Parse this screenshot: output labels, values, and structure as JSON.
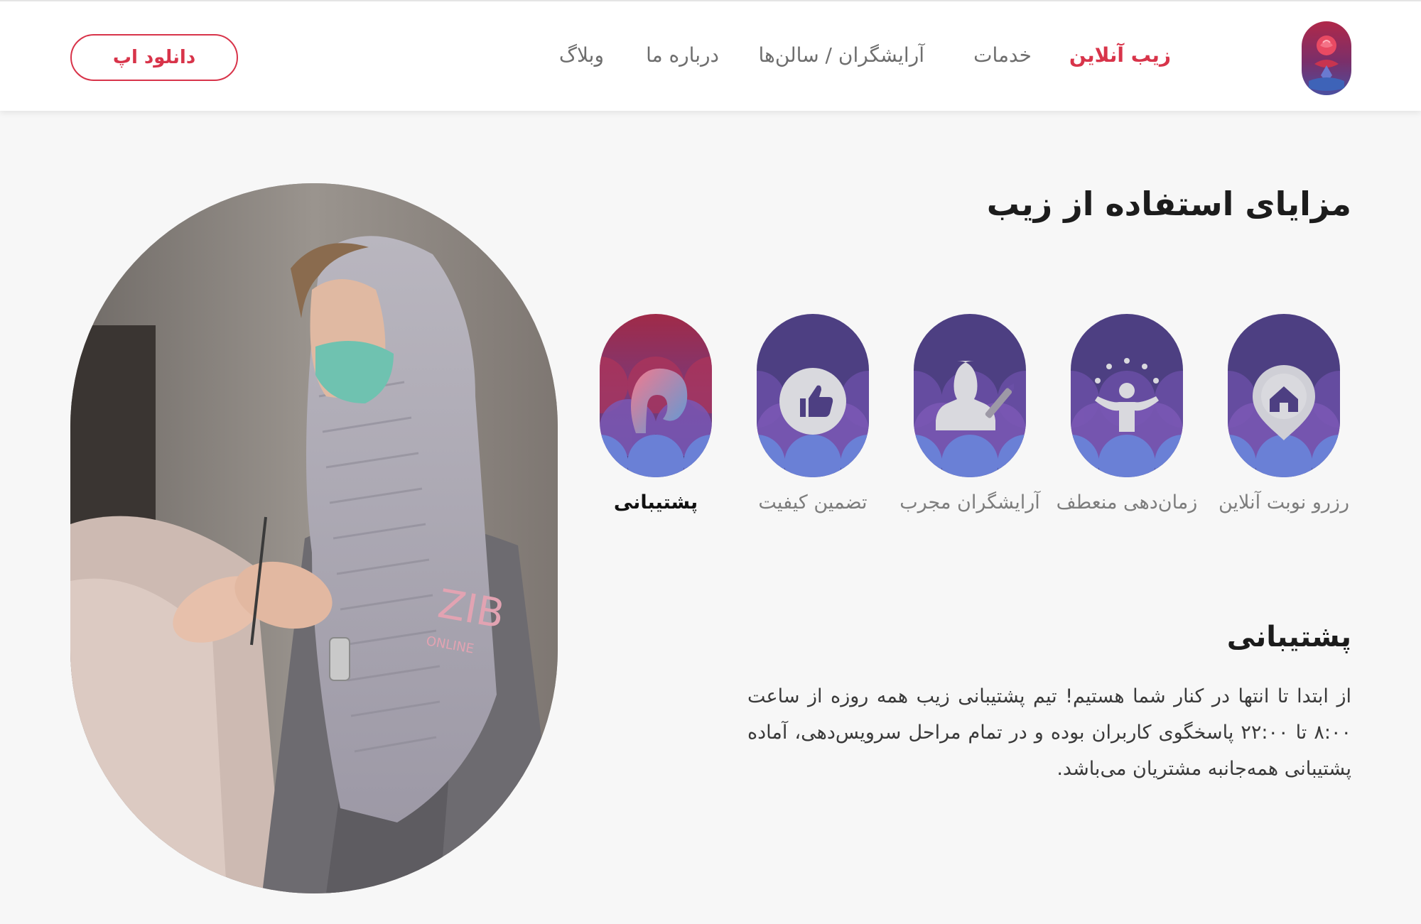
{
  "header": {
    "logo_icon": "zib-rose-logo-icon",
    "nav": [
      {
        "label": "زیب آنلاین",
        "active": true
      },
      {
        "label": "خدمات",
        "active": false
      },
      {
        "label": "آرایشگران / سالن‌ها",
        "active": false
      },
      {
        "label": "درباره ما",
        "active": false
      },
      {
        "label": "وبلاگ",
        "active": false
      }
    ],
    "download_label": "دانلود اپ"
  },
  "benefits": {
    "title": "مزایای استفاده از زیب",
    "items": [
      {
        "label": "رزرو نوبت آنلاین",
        "icon": "home-location-pin-icon"
      },
      {
        "label": "زمان‌دهی منعطف",
        "icon": "juggling-person-icon"
      },
      {
        "label": "آرایشگران مجرب",
        "icon": "stylist-with-brush-icon"
      },
      {
        "label": "تضمین کیفیت",
        "icon": "thumbs-up-icon"
      },
      {
        "label": "پشتیبانی",
        "icon": "support-hair-icon",
        "active": true
      }
    ],
    "detail": {
      "title": "پشتیبانی",
      "body": "از ابتدا تا انتها در کنار شما هستیم! تیم پشتیبانی زیب همه روزه از ساعت ۸:۰۰ تا ۲۲:۰۰ پاسخگوی کاربران بوده و در تمام مراحل سرویس‌دهی، آماده پشتیبانی همه‌جانبه مشتریان می‌باشد."
    }
  },
  "photo": {
    "uniform_text": "ZIB",
    "uniform_subtext": "ONLINE"
  },
  "colors": {
    "accent": "#d8344a",
    "pill_purple": "#4d3f82",
    "pill_active_top": "#9b2a4c"
  }
}
